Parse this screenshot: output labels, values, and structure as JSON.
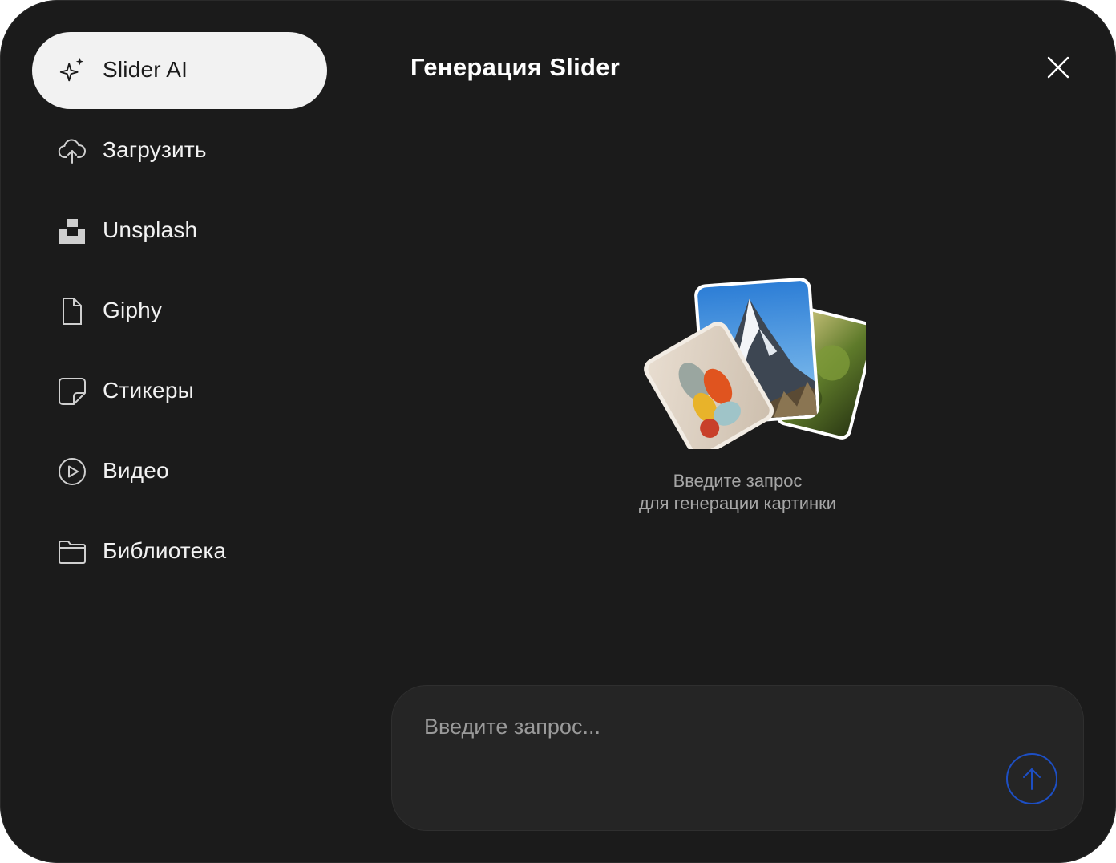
{
  "sidebar": {
    "items": [
      {
        "label": "Slider AI",
        "icon": "sparkle-icon",
        "active": true
      },
      {
        "label": "Загрузить",
        "icon": "cloud-upload-icon"
      },
      {
        "label": "Unsplash",
        "icon": "unsplash-icon"
      },
      {
        "label": "Giphy",
        "icon": "giphy-icon"
      },
      {
        "label": "Стикеры",
        "icon": "sticker-icon"
      },
      {
        "label": "Видео",
        "icon": "play-circle-icon"
      },
      {
        "label": "Библиотека",
        "icon": "folder-icon"
      }
    ]
  },
  "header": {
    "title": "Генерация Slider",
    "close_icon": "close-icon"
  },
  "empty_state": {
    "line1": "Введите запрос",
    "line2": "для генерации картинки",
    "illustration": "photo-stack-illustration"
  },
  "prompt": {
    "placeholder": "Введите запрос...",
    "value": "",
    "send_icon": "arrow-up-icon"
  },
  "colors": {
    "background": "#1b1b1b",
    "active_item": "#f2f2f2",
    "input_bg": "#252525",
    "send_accent": "#1d4fc4"
  }
}
